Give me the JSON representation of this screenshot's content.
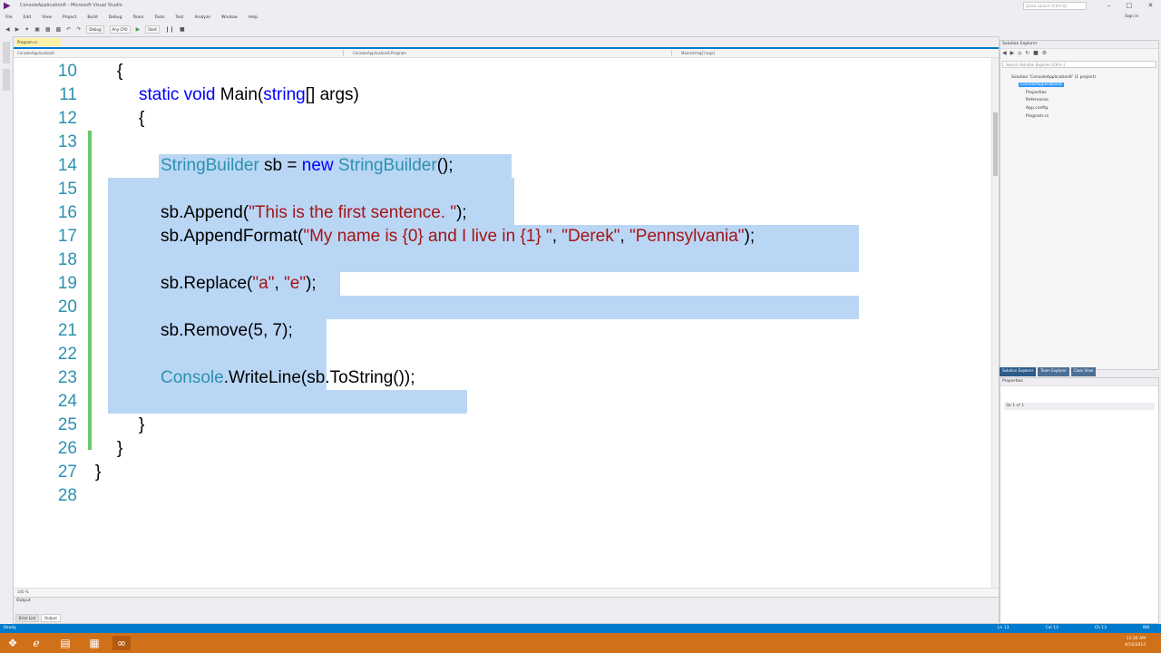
{
  "window": {
    "title": "ConsoleApplication6 - Microsoft Visual Studio",
    "quick_launch_placeholder": "Quick Launch (Ctrl+Q)",
    "sign_in": "Sign in"
  },
  "menu": [
    "File",
    "Edit",
    "View",
    "Project",
    "Build",
    "Debug",
    "Team",
    "Tools",
    "Test",
    "Analyze",
    "Window",
    "Help"
  ],
  "toolbar": {
    "config": "Debug",
    "platform": "Any CPU",
    "start_label": "Start"
  },
  "editor": {
    "tab_label": "Program.cs",
    "nav": {
      "project": "ConsoleApplication6",
      "class": "ConsoleApplication6.Program",
      "member": "Main(string[] args)"
    },
    "zoom": "100 %",
    "lines": [
      {
        "n": "10"
      },
      {
        "n": "11"
      },
      {
        "n": "12"
      },
      {
        "n": "13"
      },
      {
        "n": "14"
      },
      {
        "n": "15"
      },
      {
        "n": "16"
      },
      {
        "n": "17"
      },
      {
        "n": "18"
      },
      {
        "n": "19"
      },
      {
        "n": "20"
      },
      {
        "n": "21"
      },
      {
        "n": "22"
      },
      {
        "n": "23"
      },
      {
        "n": "24"
      },
      {
        "n": "25"
      },
      {
        "n": "26"
      },
      {
        "n": "27"
      },
      {
        "n": "28"
      }
    ],
    "code": {
      "l10": "{",
      "l11_kw": "static void",
      "l11_name": " Main(",
      "l11_type": "string",
      "l11_rest": "[] args)",
      "l12": "{",
      "l14_type1": "StringBuilder",
      "l14_mid": " sb = ",
      "l14_kw": "new",
      "l14_sp": " ",
      "l14_type2": "StringBuilder",
      "l14_end": "();",
      "l16_a": "sb.Append(",
      "l16_s": "\"This is the first sentence. \"",
      "l16_b": ");",
      "l17_a": "sb.AppendFormat(",
      "l17_s1": "\"My name is {0} and I live in {1} \"",
      "l17_c1": ", ",
      "l17_s2": "\"Derek\"",
      "l17_c2": ", ",
      "l17_s3": "\"Pennsylvania\"",
      "l17_b": ");",
      "l19_a": "sb.Replace(",
      "l19_s1": "\"a\"",
      "l19_c": ", ",
      "l19_s2": "\"e\"",
      "l19_b": ");",
      "l21": "sb.Remove(5, 7);",
      "l23_type": "Console",
      "l23_rest": ".WriteLine(sb.ToString());",
      "l25": "}",
      "l26": "}",
      "l27": "}"
    }
  },
  "output": {
    "title": "Output",
    "tabs": [
      "Error List",
      "Output"
    ]
  },
  "solution_explorer": {
    "title": "Solution Explorer",
    "search_placeholder": "Search Solution Explorer (Ctrl+;)",
    "tree": [
      "Solution 'ConsoleApplication6' (1 project)",
      "ConsoleApplication6",
      "Properties",
      "References",
      "App.config",
      "Program.cs"
    ],
    "tabs": [
      "Solution Explorer",
      "Team Explorer",
      "Class View"
    ]
  },
  "properties": {
    "title": "Properties",
    "row": "Sb  1 of 1"
  },
  "status": {
    "left": "Ready",
    "ln": "Ln 13",
    "col": "Col 13",
    "ch": "Ch 13",
    "ins": "INS"
  },
  "taskbar": {
    "time": "11:26 AM",
    "date": "4/16/2014"
  },
  "colors": {
    "accent": "#007acc",
    "selection": "#bad6f5",
    "keyword": "#0000ff",
    "type": "#2b91af",
    "string": "#a31515",
    "taskbar": "#d07018"
  }
}
